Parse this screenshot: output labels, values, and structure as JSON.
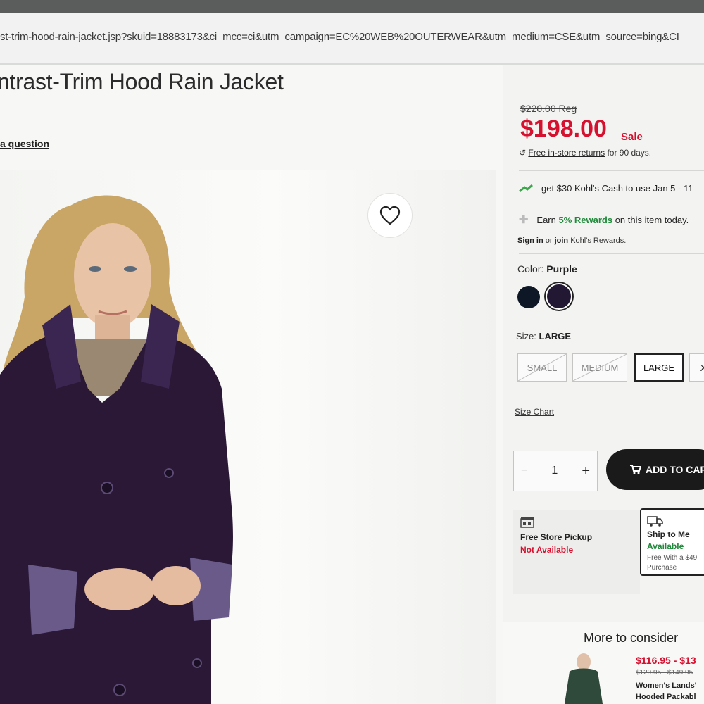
{
  "browser": {
    "url": "st-trim-hood-rain-jacket.jsp?skuid=18883173&ci_mcc=ci&utm_campaign=EC%20WEB%20OUTERWEAR&utm_medium=CSE&utm_source=bing&CI"
  },
  "product": {
    "title": "ntrast-Trim Hood Rain Jacket",
    "ask_question": "a question",
    "reg_price": "$220.00 Reg",
    "sale_price": "$198.00",
    "sale_label": "Sale",
    "returns_link": "Free in-store returns",
    "returns_suffix": " for 90 days.",
    "kohls_cash": "get $30 Kohl's Cash to use Jan 5 - 11",
    "earn_prefix": "Earn ",
    "earn_highlight": "5% Rewards",
    "earn_suffix": " on this item today.",
    "signin_link": "Sign in",
    "signin_or": " or ",
    "join_link": "join",
    "signin_suffix": " Kohl's Rewards.",
    "color_label": "Color: ",
    "color_value": "Purple",
    "size_label": "Size: ",
    "size_value": "LARGE",
    "sizes": [
      "SMALL",
      "MEDIUM",
      "LARGE",
      "X"
    ],
    "size_chart": "Size Chart",
    "quantity": "1",
    "qty_minus": "−",
    "qty_plus": "+",
    "add_to_cart": "ADD TO CAR",
    "pickup_title": "Free Store Pickup",
    "pickup_status": "Not Available",
    "ship_title": "Ship to Me",
    "ship_status": "Available",
    "ship_note": "Free With a $49 Purchase"
  },
  "recommendations": {
    "title": "More to consider",
    "item_price": "$116.95 - $13",
    "item_reg": "$129.95 - $149.95",
    "item_name_1": "Women's Lands'",
    "item_name_2": "Hooded Packabl"
  },
  "colors": {
    "sale_red": "#d5112f",
    "rewards_green": "#1e8a3a",
    "swatch_navy": "#0e1726",
    "swatch_purple": "#231834"
  }
}
